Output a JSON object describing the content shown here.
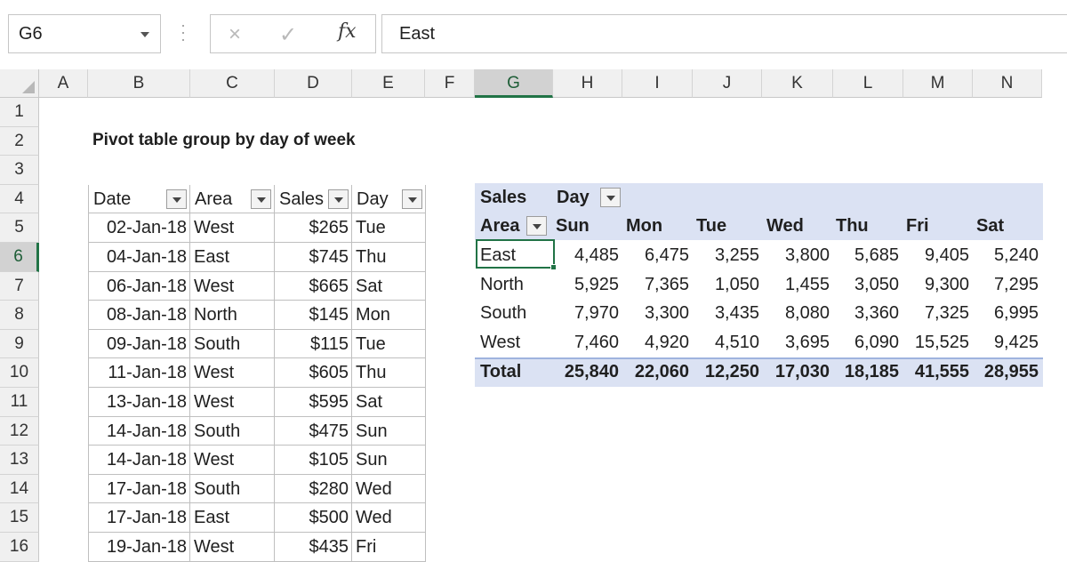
{
  "formula_bar": {
    "name_box": "G6",
    "cancel_icon": "×",
    "enter_icon": "✓",
    "fx_label": "fx",
    "formula": "East"
  },
  "columns": [
    "A",
    "B",
    "C",
    "D",
    "E",
    "F",
    "G",
    "H",
    "I",
    "J",
    "K",
    "L",
    "M",
    "N"
  ],
  "rows": [
    "1",
    "2",
    "3",
    "4",
    "5",
    "6",
    "7",
    "8",
    "9",
    "10",
    "11",
    "12",
    "13",
    "14",
    "15",
    "16"
  ],
  "selected_col": "G",
  "selected_row": "6",
  "title": "Pivot table group by day of week",
  "source_table": {
    "headers": [
      "Date",
      "Area",
      "Sales",
      "Day"
    ],
    "rows": [
      [
        "02-Jan-18",
        "West",
        "$265",
        "Tue"
      ],
      [
        "04-Jan-18",
        "East",
        "$745",
        "Thu"
      ],
      [
        "06-Jan-18",
        "West",
        "$665",
        "Sat"
      ],
      [
        "08-Jan-18",
        "North",
        "$145",
        "Mon"
      ],
      [
        "09-Jan-18",
        "South",
        "$115",
        "Tue"
      ],
      [
        "11-Jan-18",
        "West",
        "$605",
        "Thu"
      ],
      [
        "13-Jan-18",
        "West",
        "$595",
        "Sat"
      ],
      [
        "14-Jan-18",
        "South",
        "$475",
        "Sun"
      ],
      [
        "14-Jan-18",
        "West",
        "$105",
        "Sun"
      ],
      [
        "17-Jan-18",
        "South",
        "$280",
        "Wed"
      ],
      [
        "17-Jan-18",
        "East",
        "$500",
        "Wed"
      ],
      [
        "19-Jan-18",
        "West",
        "$435",
        "Fri"
      ]
    ]
  },
  "pivot": {
    "values_label": "Sales",
    "column_field": "Day",
    "row_field": "Area",
    "day_headers": [
      "Sun",
      "Mon",
      "Tue",
      "Wed",
      "Thu",
      "Fri",
      "Sat"
    ],
    "rows": [
      {
        "area": "East",
        "values": [
          "4,485",
          "6,475",
          "3,255",
          "3,800",
          "5,685",
          "9,405",
          "5,240"
        ]
      },
      {
        "area": "North",
        "values": [
          "5,925",
          "7,365",
          "1,050",
          "1,455",
          "3,050",
          "9,300",
          "7,295"
        ]
      },
      {
        "area": "South",
        "values": [
          "7,970",
          "3,300",
          "3,435",
          "8,080",
          "3,360",
          "7,325",
          "6,995"
        ]
      },
      {
        "area": "West",
        "values": [
          "7,460",
          "4,920",
          "4,510",
          "3,695",
          "6,090",
          "15,525",
          "9,425"
        ]
      }
    ],
    "total_label": "Total",
    "totals": [
      "25,840",
      "22,060",
      "12,250",
      "17,030",
      "18,185",
      "41,555",
      "28,955"
    ]
  },
  "colors": {
    "accent": "#217346",
    "pivot_band": "#dbe2f3"
  }
}
